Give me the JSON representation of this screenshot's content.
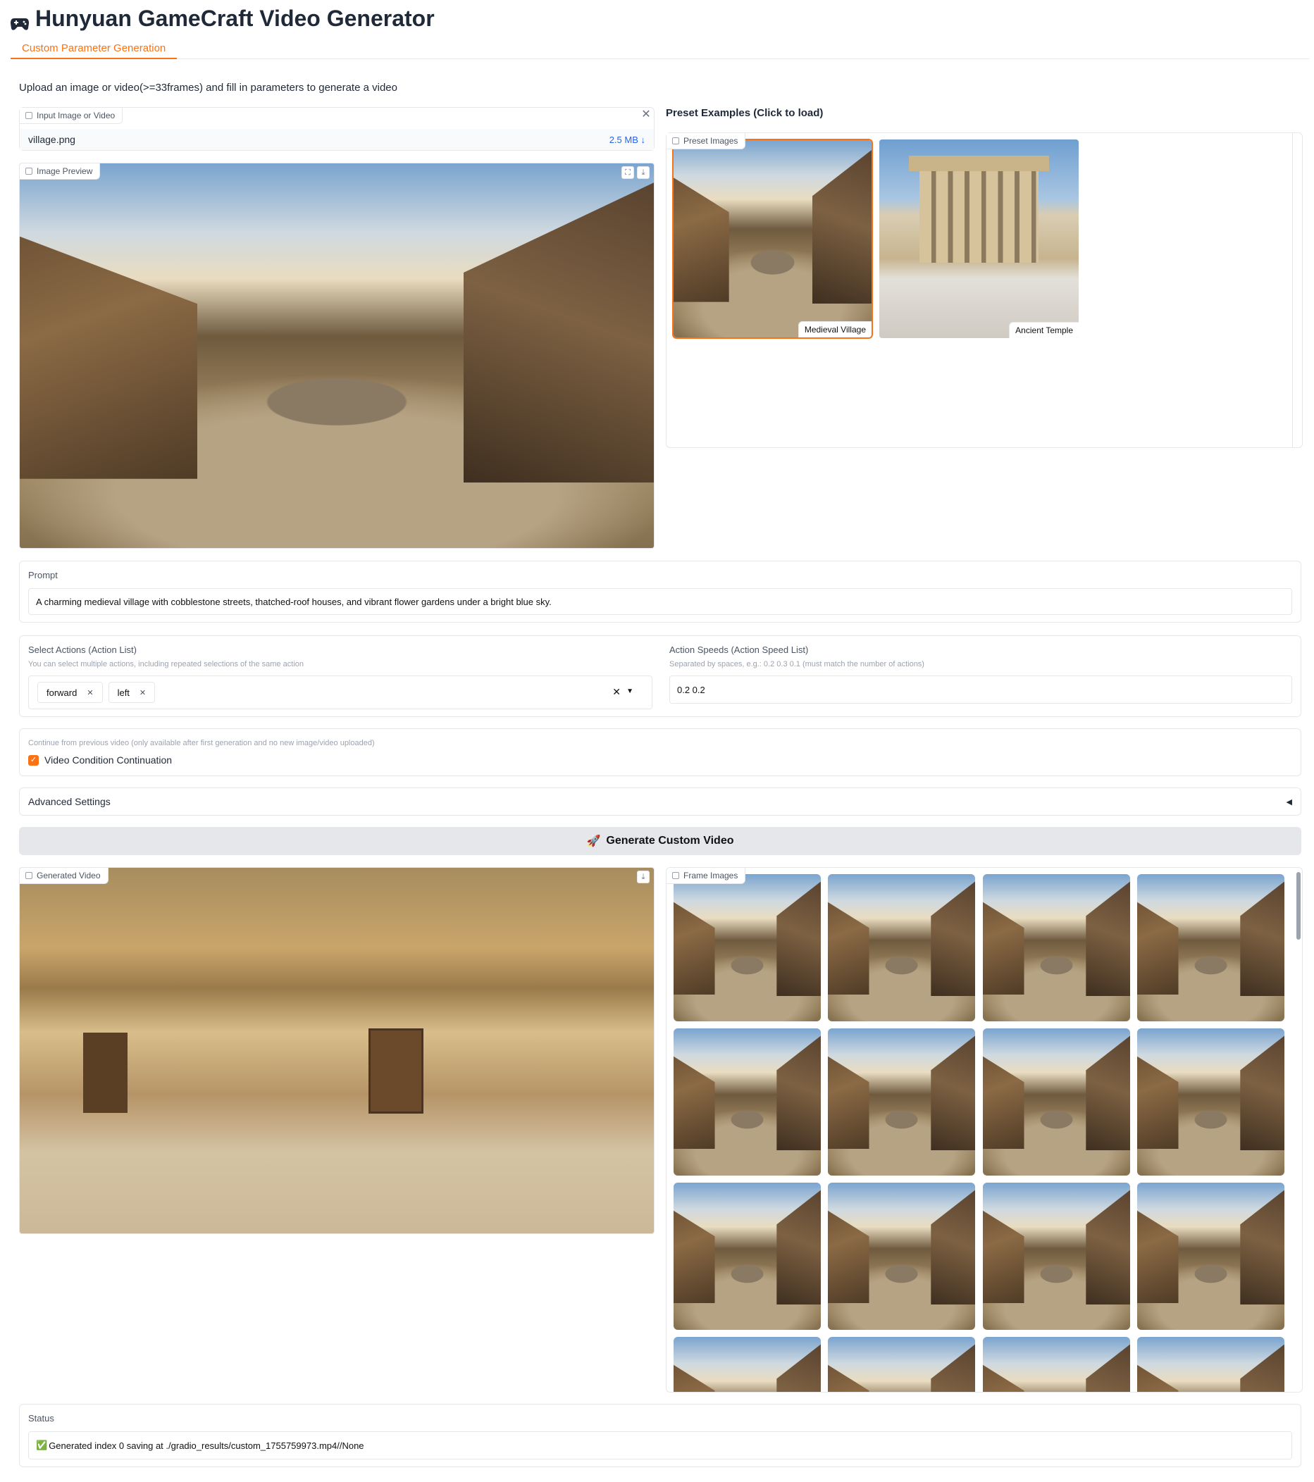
{
  "header": {
    "title": "Hunyuan GameCraft Video Generator",
    "icon": "gamepad-icon"
  },
  "tabs": [
    {
      "label": "Custom Parameter Generation",
      "active": true
    }
  ],
  "description": "Upload an image or video(>=33frames) and fill in parameters to generate a video",
  "input_file": {
    "label": "Input Image or Video",
    "filename": "village.png",
    "size": "2.5 MB ↓"
  },
  "image_preview": {
    "label": "Image Preview"
  },
  "presets": {
    "heading": "Preset Examples (Click to load)",
    "label": "Preset Images",
    "items": [
      {
        "caption": "Medieval Village",
        "selected": true
      },
      {
        "caption": "Ancient Temple",
        "selected": false
      }
    ]
  },
  "prompt": {
    "label": "Prompt",
    "value": "A charming medieval village with cobblestone streets, thatched-roof houses, and vibrant flower gardens under a bright blue sky."
  },
  "actions": {
    "label": "Select Actions (Action List)",
    "info": "You can select multiple actions, including repeated selections of the same action",
    "selected": [
      "forward",
      "left"
    ]
  },
  "speeds": {
    "label": "Action Speeds (Action Speed List)",
    "info": "Separated by spaces, e.g.: 0.2 0.3 0.1 (must match the number of actions)",
    "value": "0.2 0.2"
  },
  "continuation": {
    "info": "Continue from previous video (only available after first generation and no new image/video uploaded)",
    "checkbox_label": "Video Condition Continuation",
    "checked": true
  },
  "advanced": {
    "label": "Advanced Settings",
    "arrow": "◀"
  },
  "generate_button": {
    "label": "Generate Custom Video",
    "icon": "🚀"
  },
  "generated_video": {
    "label": "Generated Video"
  },
  "frame_images": {
    "label": "Frame Images",
    "count_visible": 16
  },
  "status": {
    "label": "Status",
    "icon": "✅",
    "value": "Generated index 0 saving at ./gradio_results/custom_1755759973.mp4//None"
  }
}
